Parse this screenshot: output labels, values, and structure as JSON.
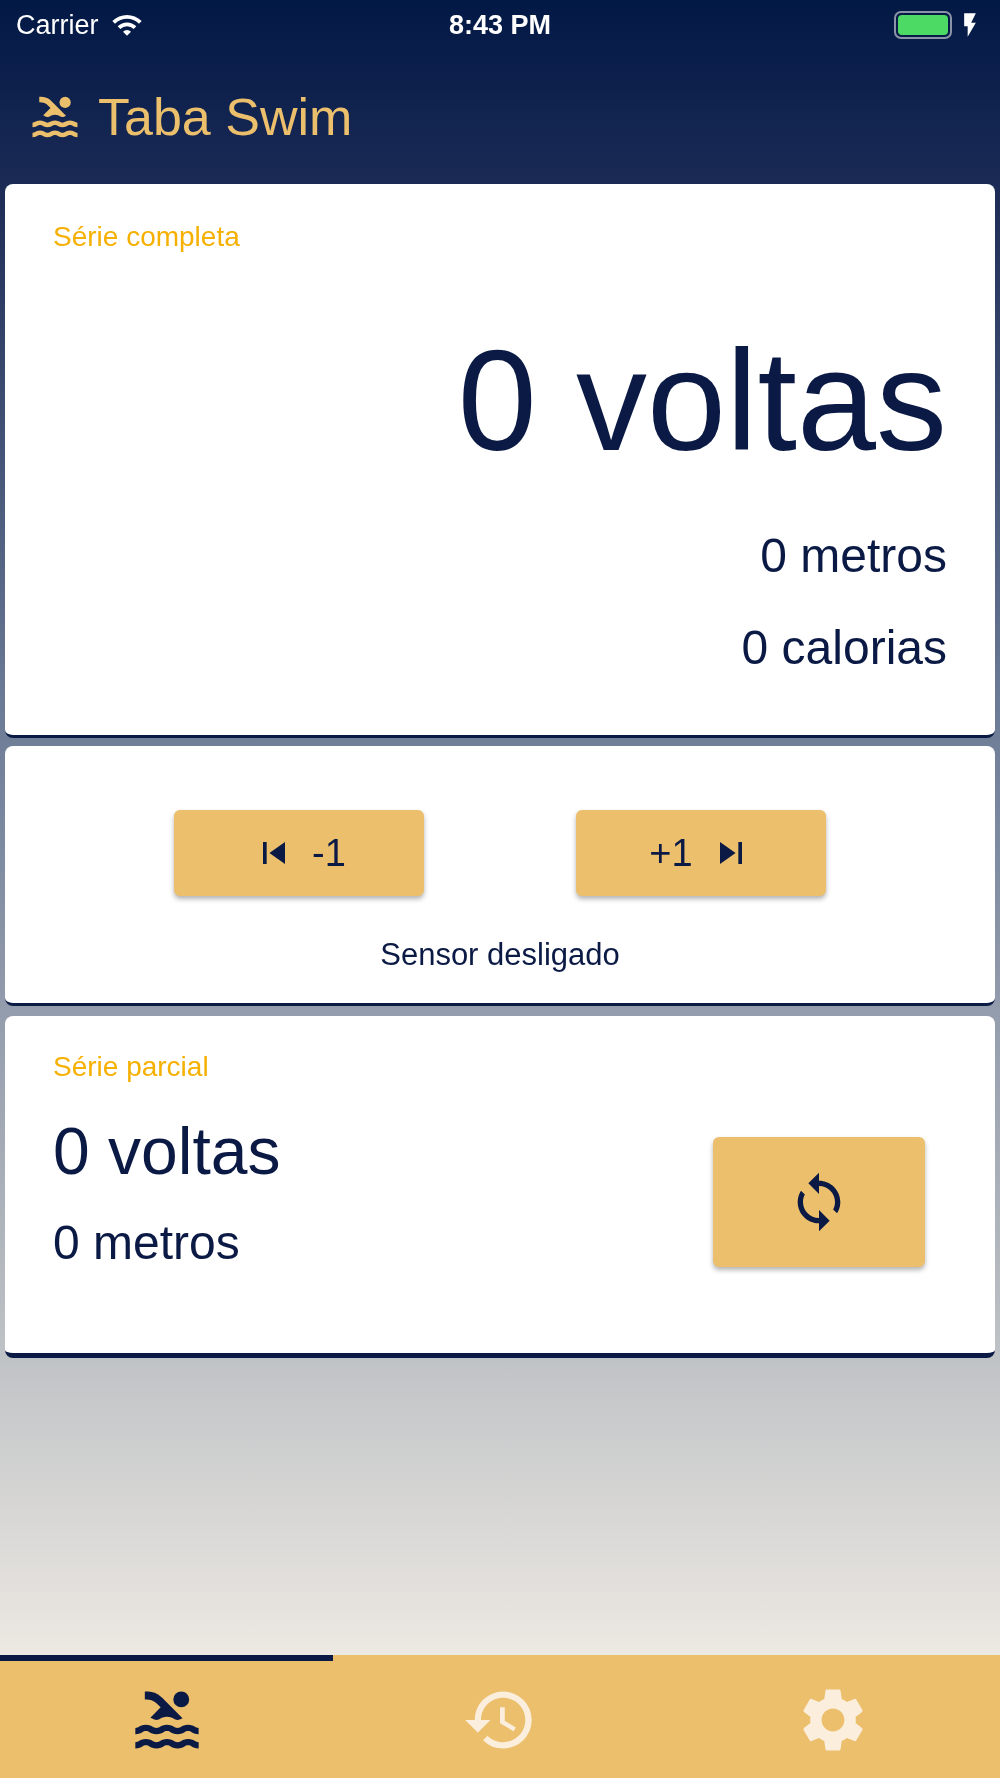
{
  "status_bar": {
    "carrier": "Carrier",
    "time": "8:43 PM"
  },
  "header": {
    "title": "Taba Swim"
  },
  "full_series": {
    "label": "Série completa",
    "laps": "0 voltas",
    "meters": "0 metros",
    "calories": "0 calorias"
  },
  "controls": {
    "buttons": [
      {
        "kind": "previous",
        "label": "-1"
      },
      {
        "kind": "next",
        "label": "+1"
      }
    ],
    "sensor_status": "Sensor desligado"
  },
  "partial_series": {
    "label": "Série parcial",
    "laps": "0 voltas",
    "meters": "0 metros"
  },
  "tabs": [
    {
      "kind": "swim",
      "selected": true
    },
    {
      "kind": "history",
      "selected": false
    },
    {
      "kind": "settings",
      "selected": false
    }
  ]
}
